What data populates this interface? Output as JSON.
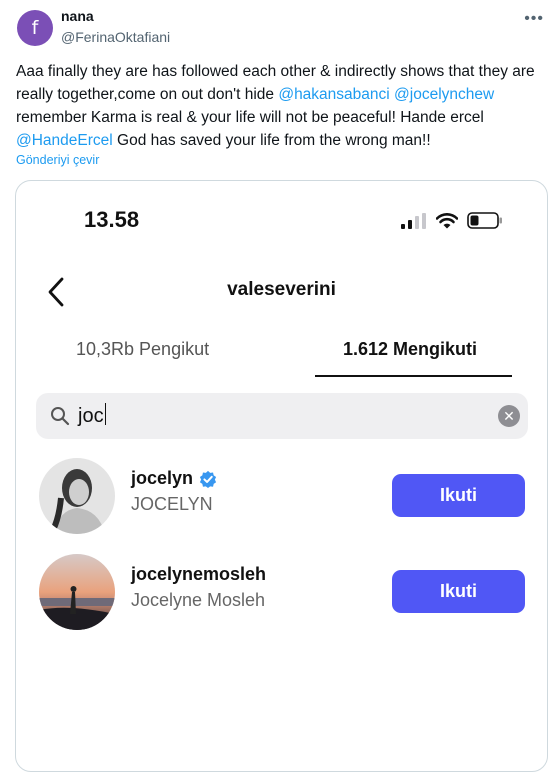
{
  "tweet": {
    "avatar_letter": "f",
    "avatar_color": "#7b4fb6",
    "display_name": "nana",
    "handle": "@FerinaOktafiani",
    "more_icon": "more-horizontal-icon",
    "text_part1": "Aaa finally they are has followed each other & indirectly shows that they are really together,come on out don't hide ",
    "mention1": "@hakansabanci",
    "text_part2": " ",
    "mention2": "@jocelynchew",
    "text_part3": " remember Karma is real & your life will not be peaceful! Hande ercel ",
    "mention3": "@HandeErcel",
    "text_part4": " God has saved your life from the wrong man!!",
    "translate_label": "Gönderiyi çevir",
    "link_color": "#1d9bf0"
  },
  "screenshot": {
    "time": "13.58",
    "profile_name": "valeseverini",
    "tabs": [
      {
        "label": "10,3Rb Pengikut"
      },
      {
        "label": "1.612 Mengikuti"
      }
    ],
    "search": {
      "value": "joc"
    },
    "follow_color": "#5057f5",
    "results": [
      {
        "username": "jocelyn",
        "full_name": "JOCELYN",
        "verified": true,
        "button_label": "Ikuti"
      },
      {
        "username": "jocelynemosleh",
        "full_name": "Jocelyne Mosleh",
        "verified": false,
        "button_label": "Ikuti"
      }
    ]
  }
}
